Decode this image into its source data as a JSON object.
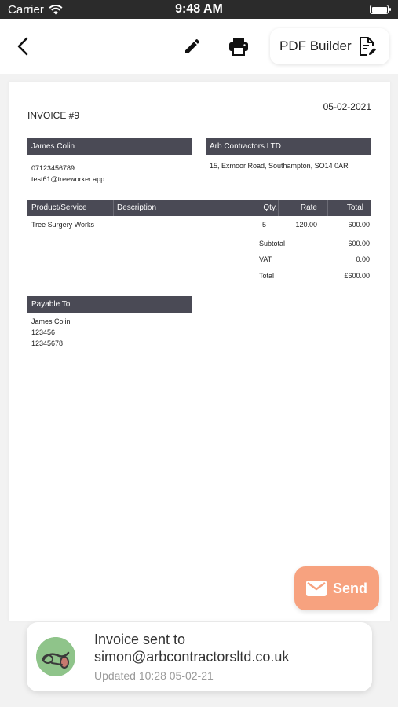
{
  "status_bar": {
    "carrier": "Carrier",
    "time": "9:48 AM"
  },
  "nav": {
    "pdf_builder_label": "PDF Builder"
  },
  "invoice": {
    "title": "INVOICE #9",
    "date": "05-02-2021",
    "client": {
      "name": "James Colin",
      "phone": "07123456789",
      "email": "test61@treeworker.app"
    },
    "company": {
      "name": "Arb Contractors LTD",
      "address": "15, Exmoor Road, Southampton, SO14 0AR"
    },
    "table": {
      "headers": {
        "product": "Product/Service",
        "description": "Description",
        "qty": "Qty.",
        "rate": "Rate",
        "total": "Total"
      },
      "rows": [
        {
          "product": "Tree Surgery Works",
          "description": "",
          "qty": "5",
          "rate": "120.00",
          "total": "600.00"
        }
      ]
    },
    "totals": {
      "subtotal_label": "Subtotal",
      "subtotal": "600.00",
      "vat_label": "VAT",
      "vat": "0.00",
      "total_label": "Total",
      "total": "£600.00"
    },
    "payable": {
      "header": "Payable To",
      "name": "James Colin",
      "line2": "123456",
      "line3": "12345678"
    }
  },
  "send_button": {
    "label": "Send"
  },
  "toast": {
    "line1": "Invoice sent to",
    "line2": "simon@arbcontractorsltd.co.uk",
    "updated": "Updated 10:28  05-02-21"
  },
  "colors": {
    "header_bar": "#4a4a55",
    "send_button": "#f7a27f",
    "avatar_bg": "#8fc48a",
    "status_bar": "#2b2b2b"
  },
  "icons": [
    "wifi-icon",
    "battery-icon",
    "back-chevron-icon",
    "pencil-icon",
    "printer-icon",
    "document-edit-icon",
    "mail-icon",
    "tree-logo-icon"
  ]
}
